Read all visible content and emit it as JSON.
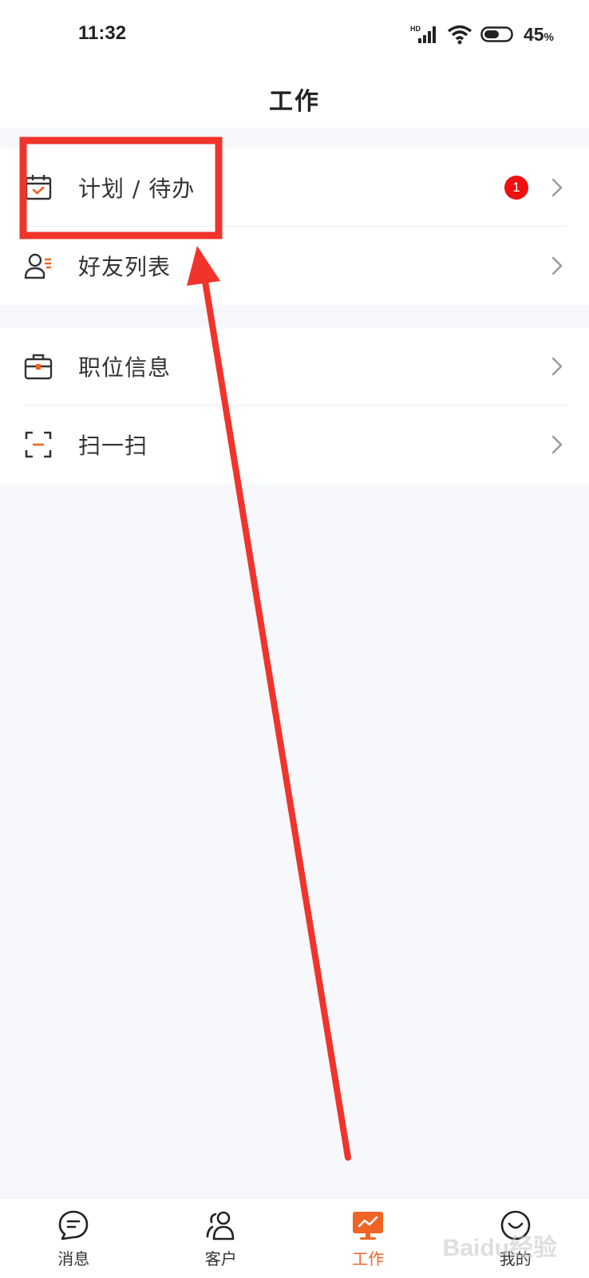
{
  "status_bar": {
    "time": "11:32",
    "network": "HD",
    "battery_percent": "45",
    "battery_unit": "%"
  },
  "header": {
    "title": "工作"
  },
  "menu": {
    "group1": [
      {
        "label": "计划 / 待办",
        "icon": "calendar-check-icon",
        "badge": "1"
      },
      {
        "label": "好友列表",
        "icon": "person-list-icon"
      }
    ],
    "group2": [
      {
        "label": "职位信息",
        "icon": "briefcase-icon"
      },
      {
        "label": "扫一扫",
        "icon": "scan-icon"
      }
    ]
  },
  "tabbar": {
    "items": [
      {
        "label": "消息",
        "icon": "chat-bubble-icon",
        "active": false
      },
      {
        "label": "客户",
        "icon": "contacts-icon",
        "active": false
      },
      {
        "label": "工作",
        "icon": "work-monitor-icon",
        "active": true
      },
      {
        "label": "我的",
        "icon": "smiley-icon",
        "active": false
      }
    ]
  },
  "colors": {
    "accent": "#f06423",
    "badge": "#ee1111",
    "annotation": "#f0342c",
    "page_bg": "#f6f8fc"
  },
  "watermark": "Baidu经验"
}
